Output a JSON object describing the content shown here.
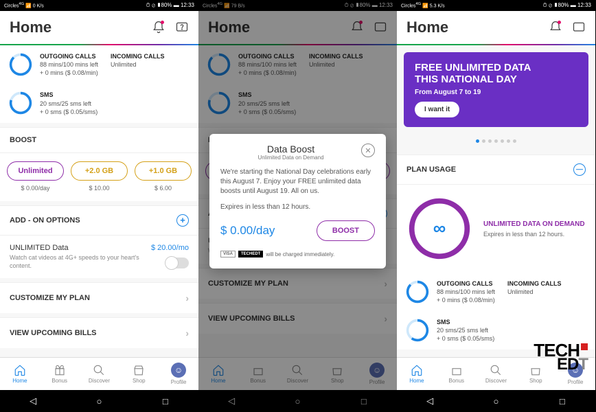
{
  "status": {
    "carrier": "Circles",
    "net1": "0 K/s",
    "net2": "79 B/s",
    "net3": "5.3 K/s",
    "right": "⏱ ⊘ ▮80% ▬ 12:33"
  },
  "header": {
    "title": "Home"
  },
  "usage": {
    "outgoing": {
      "label": "OUTGOING CALLS",
      "line1": "88 mins/100 mins left",
      "line2": "+ 0 mins ($ 0.08/min)"
    },
    "incoming": {
      "label": "INCOMING CALLS",
      "line1": "Unlimited"
    },
    "sms": {
      "label": "SMS",
      "line1": "20 sms/25 sms left",
      "line2": "+ 0 sms ($ 0.05/sms)"
    }
  },
  "boost": {
    "title": "BOOST",
    "items": [
      {
        "label": "Unlimited",
        "price": "$ 0.00/day",
        "cls": "purple"
      },
      {
        "label": "+2.0 GB",
        "price": "$ 10.00",
        "cls": "gold"
      },
      {
        "label": "+1.0 GB",
        "price": "$ 6.00",
        "cls": "gold"
      }
    ]
  },
  "addon": {
    "title": "ADD - ON OPTIONS",
    "item_title": "UNLIMITED Data",
    "item_sub": "Watch cat videos at 4G+ speeds to your heart's content.",
    "price": "$ 20.00/mo"
  },
  "links": {
    "customize": "CUSTOMIZE MY PLAN",
    "bills": "VIEW UPCOMING BILLS"
  },
  "nav": {
    "home": "Home",
    "bonus": "Bonus",
    "discover": "Discover",
    "shop": "Shop",
    "profile": "Profile"
  },
  "modal": {
    "title": "Data Boost",
    "subtitle": "Unlimited Data on Demand",
    "body": "We're starting the National Day celebrations early this August 7. Enjoy your FREE unlimited data boosts until August 19.  All on us.",
    "expire": "Expires in less than 12 hours.",
    "price": "$ 0.00/day",
    "button": "BOOST",
    "card1": "VISA",
    "card2": "TECHEDT",
    "foot": "will be charged immediately."
  },
  "promo": {
    "line1a": "FREE UNLIMITED DATA",
    "line1b": "THIS NATIONAL DAY",
    "line2": "From August 7 to 19",
    "button": "I want it"
  },
  "plan": {
    "title": "PLAN USAGE",
    "unlimited": "UNLIMITED DATA ON DEMAND",
    "expire": "Expires in less than 12 hours."
  },
  "watermark": {
    "top": "TECH",
    "bottom": "ED",
    "gray": "T"
  }
}
